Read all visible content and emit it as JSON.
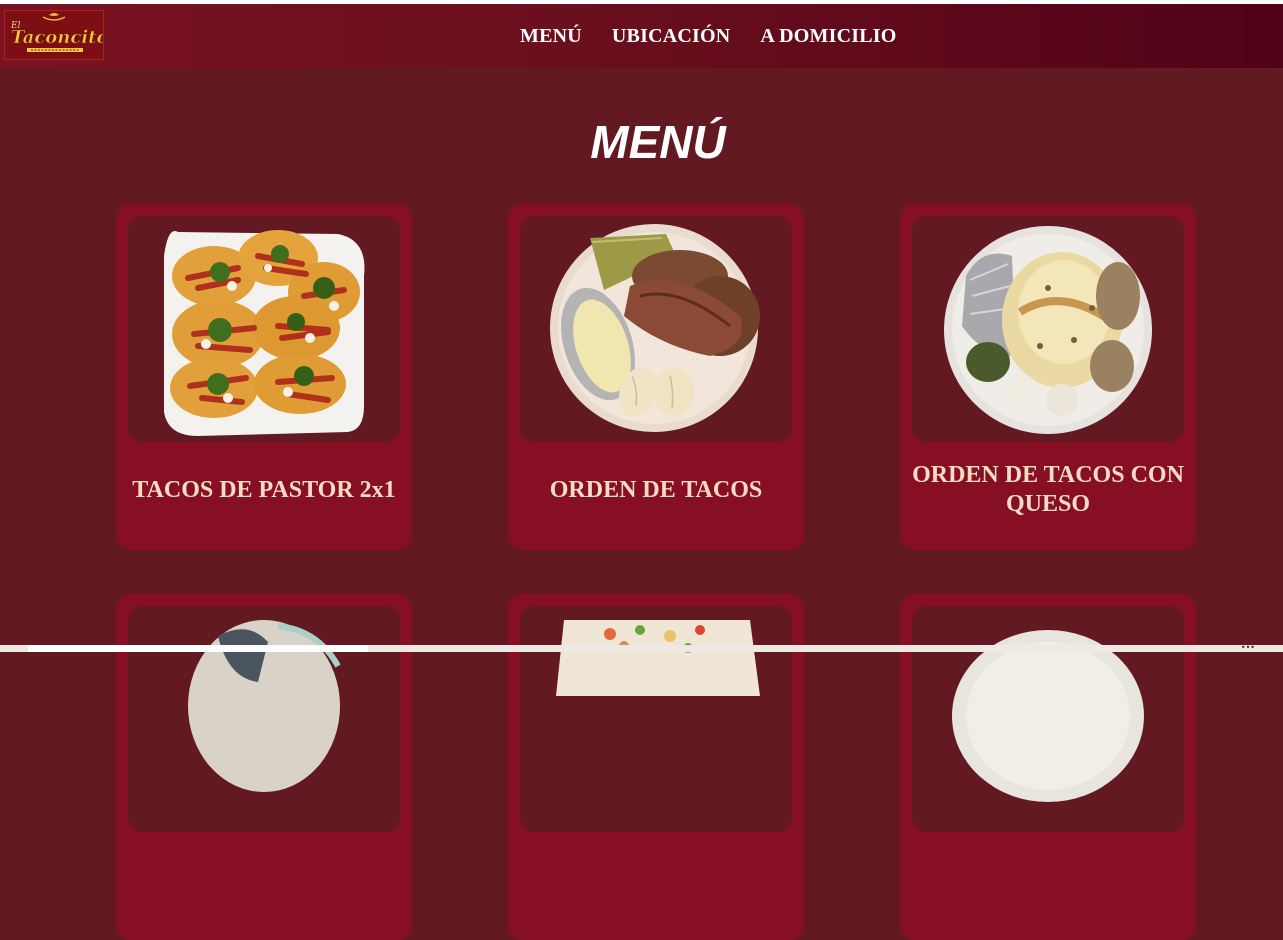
{
  "brand": {
    "logo_text": "Taconcito",
    "logo_prefix": "El"
  },
  "nav": {
    "items": [
      "MENÚ",
      "UBICACIÓN",
      "A DOMICILIO"
    ]
  },
  "page": {
    "title": "MENÚ"
  },
  "menu": {
    "items": [
      {
        "title": "TACOS DE PASTOR 2x1"
      },
      {
        "title": "ORDEN DE TACOS"
      },
      {
        "title": "ORDEN DE TACOS CON QUESO"
      }
    ]
  },
  "colors": {
    "background": "#631921",
    "card": "#870f24",
    "card_title": "#f6dcc3",
    "nav_text": "#ffffff"
  }
}
